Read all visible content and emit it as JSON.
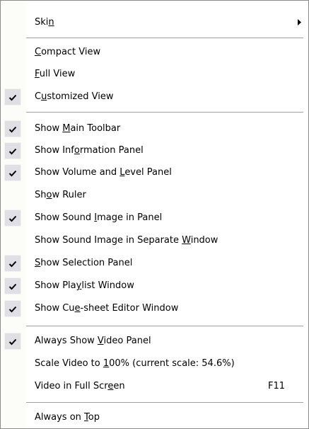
{
  "menu": {
    "items": [
      {
        "pre": "Ski",
        "key": "n",
        "post": "",
        "checked": false,
        "submenu": true
      },
      {
        "pre": "",
        "key": "C",
        "post": "ompact View",
        "checked": false
      },
      {
        "pre": "",
        "key": "F",
        "post": "ull View",
        "checked": false
      },
      {
        "pre": "C",
        "key": "u",
        "post": "stomized View",
        "checked": true
      },
      {
        "pre": "Show ",
        "key": "M",
        "post": "ain Toolbar",
        "checked": true
      },
      {
        "pre": "Show Inf",
        "key": "o",
        "post": "rmation Panel",
        "checked": true
      },
      {
        "pre": "Show Volume and ",
        "key": "L",
        "post": "evel Panel",
        "checked": true
      },
      {
        "pre": "Sh",
        "key": "o",
        "post": "w Ruler",
        "checked": false
      },
      {
        "pre": "Show Sound ",
        "key": "I",
        "post": "mage in Panel",
        "checked": true
      },
      {
        "pre": "Show Sound Image in Separate ",
        "key": "W",
        "post": "indow",
        "checked": false
      },
      {
        "pre": "",
        "key": "S",
        "post": "how Selection Panel",
        "checked": true
      },
      {
        "pre": "Show Pla",
        "key": "y",
        "post": "list Window",
        "checked": true
      },
      {
        "pre": "Show Cu",
        "key": "e",
        "post": "-sheet Editor Window",
        "checked": true
      },
      {
        "pre": "Always Show ",
        "key": "V",
        "post": "ideo Panel",
        "checked": true
      },
      {
        "pre": "Scale Video to ",
        "key": "1",
        "post": "00% (current scale: 54.6%)",
        "checked": false
      },
      {
        "pre": "Video in Full Scr",
        "key": "e",
        "post": "en",
        "checked": false,
        "shortcut": "F11"
      },
      {
        "pre": "Always on ",
        "key": "T",
        "post": "op",
        "checked": false
      }
    ]
  },
  "icons": {
    "check": "checkmark-icon",
    "submenu": "submenu-arrow-icon"
  }
}
